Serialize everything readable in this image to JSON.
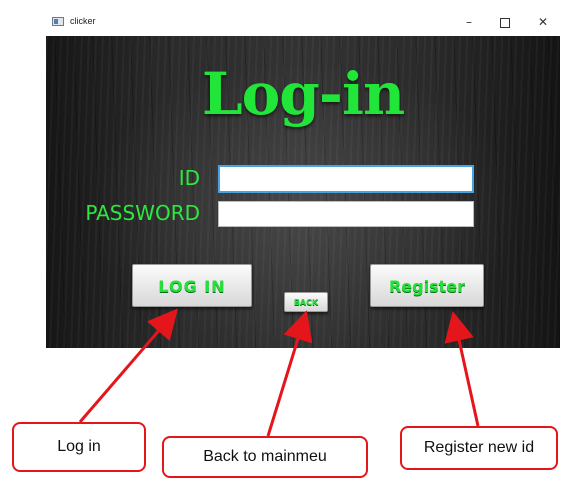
{
  "window": {
    "title": "clicker",
    "minimize_glyph": "–",
    "close_glyph": "✕"
  },
  "screen": {
    "heading": "Log-in",
    "id_label": "ID",
    "password_label": "PASSWORD",
    "id_value": "",
    "password_value": "",
    "login_button": "LOG IN",
    "back_button": "BACK",
    "register_button": "Register"
  },
  "annotations": {
    "login": "Log in",
    "back": "Back to mainmeu",
    "register": "Register new id"
  },
  "colors": {
    "accent_green": "#22e53a",
    "arrow_red": "#e4161b",
    "focus_blue": "#4aa3e0"
  }
}
